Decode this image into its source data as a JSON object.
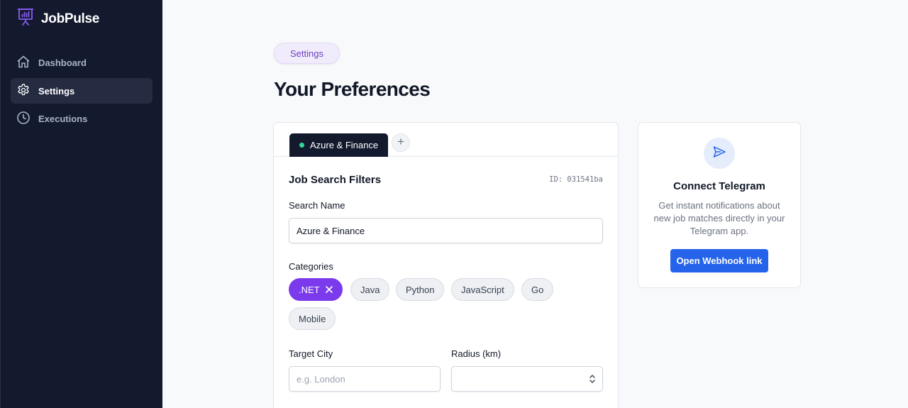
{
  "app": {
    "name": "JobPulse",
    "logo_icon": "presentation-chart-icon",
    "accent": "#7c3aed"
  },
  "sidebar": {
    "items": [
      {
        "label": "Dashboard",
        "icon": "home-icon",
        "active": false
      },
      {
        "label": "Settings",
        "icon": "gear-icon",
        "active": true
      },
      {
        "label": "Executions",
        "icon": "clock-icon",
        "active": false
      }
    ]
  },
  "header": {
    "breadcrumb": "Settings",
    "title": "Your Preferences"
  },
  "search_tabs": {
    "items": [
      {
        "label": "Azure & Finance",
        "status_color": "#34d399"
      }
    ],
    "add_label": "+"
  },
  "filters": {
    "title": "Job Search Filters",
    "record_id": "ID: 031541ba",
    "search_name": {
      "label": "Search Name",
      "value": "Azure & Finance"
    },
    "categories": {
      "label": "Categories",
      "items": [
        {
          "label": ".NET",
          "selected": true,
          "remove_icon": "close-icon"
        },
        {
          "label": "Java",
          "selected": false
        },
        {
          "label": "Python",
          "selected": false
        },
        {
          "label": "JavaScript",
          "selected": false
        },
        {
          "label": "Go",
          "selected": false
        },
        {
          "label": "Mobile",
          "selected": false
        }
      ]
    },
    "target_city": {
      "label": "Target City",
      "value": "",
      "placeholder": "e.g. London"
    },
    "radius": {
      "label": "Radius (km)",
      "value": ""
    }
  },
  "telegram": {
    "icon": "send-icon",
    "title": "Connect Telegram",
    "description": "Get instant notifications about new job matches directly in your Telegram app.",
    "button_label": "Open Webhook link",
    "button_color": "#2563eb"
  }
}
